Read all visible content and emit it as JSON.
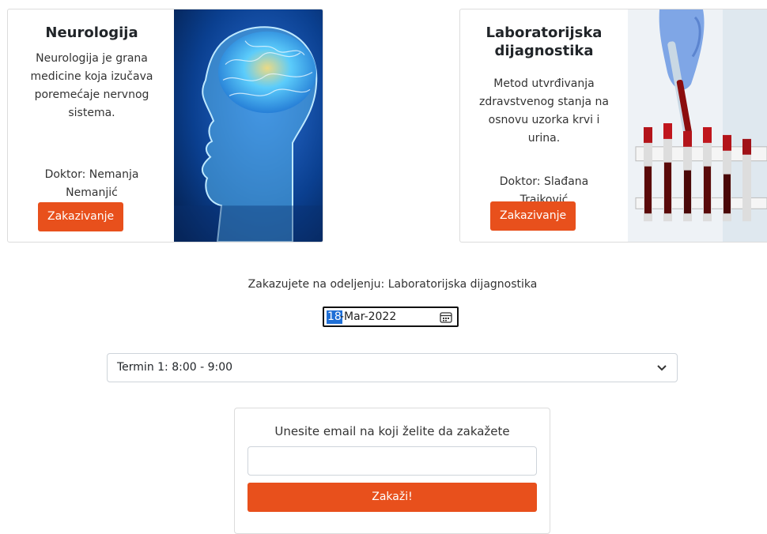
{
  "cards": [
    {
      "title": "Neurologija",
      "description": "Neurologija je grana medicine koja izučava poremećaje nervnog sistema.",
      "doctor_line1": "Doktor: Nemanja",
      "doctor_line2": "Nemanjić",
      "button": "Zakazivanje"
    },
    {
      "title_line1": "Laboratorijska",
      "title_line2": "dijagnostika",
      "description": "Metod utvrđivanja zdravstvenog stanja na osnovu uzorka krvi i urina.",
      "doctor_line1": "Doktor: Slađana",
      "doctor_line2": "Trajković",
      "button": "Zakazivanje"
    }
  ],
  "booking": {
    "department_text": "Zakazujete na odeljenju: Laboratorijska dijagnostika",
    "date_day": "18",
    "date_rest": "-Mar-2022",
    "slot_selected": "Termin 1: 8:00 - 9:00",
    "email_label": "Unesite email na koji želite da zakažete",
    "email_value": "",
    "submit_label": "Zakaži!"
  },
  "colors": {
    "accent": "#e8501c",
    "date_highlight": "#1f6fd6"
  },
  "icons": [
    "brain-head-image",
    "lab-test-tubes-image",
    "calendar-icon",
    "chevron-down-icon"
  ]
}
